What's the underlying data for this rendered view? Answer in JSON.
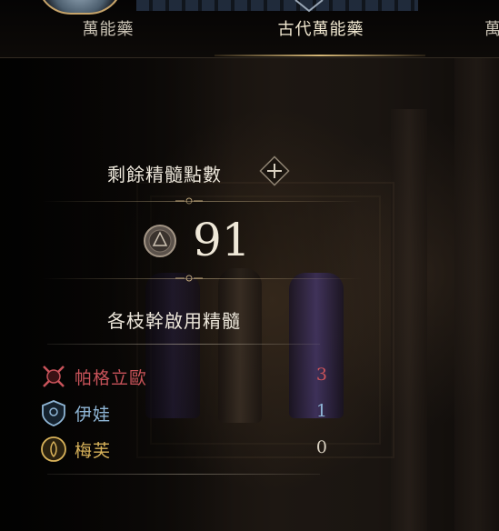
{
  "tabs": [
    {
      "label": "萬能藥",
      "active": false
    },
    {
      "label": "古代萬能藥",
      "active": true
    },
    {
      "label": "萬",
      "active": false
    }
  ],
  "essence": {
    "remaining_label": "剩餘精髓點數",
    "remaining_value": "91"
  },
  "branches": {
    "title": "各枝幹啟用精髓",
    "items": [
      {
        "name": "帕格立歐",
        "value": "3",
        "color": "#c9535a",
        "icon": "pagrio-icon"
      },
      {
        "name": "伊娃",
        "value": "1",
        "color": "#8fb6d6",
        "icon": "eva-icon"
      },
      {
        "name": "梅芙",
        "value": "0",
        "color": "#d8b25a",
        "icon": "maphr-icon"
      }
    ]
  },
  "colors": {
    "accent_gold": "#d6b777",
    "text_main": "#ece6da"
  }
}
